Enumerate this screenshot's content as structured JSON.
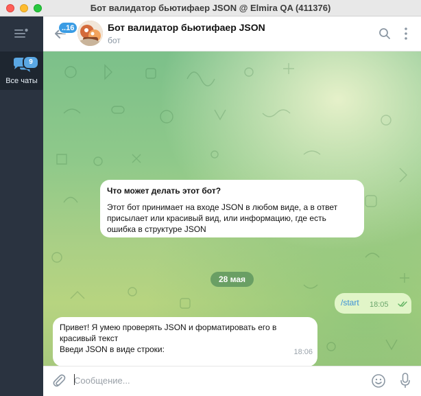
{
  "window": {
    "title": "Бот валидатор бьютифаер JSON @ Elmira QA (411376)"
  },
  "sidebar": {
    "folder_label": "Все чаты",
    "folder_badge": "9"
  },
  "header": {
    "back_badge": "..16",
    "chat_title": "Бот валидатор бьютифаер JSON",
    "chat_subtitle": "бот"
  },
  "messages": {
    "info_title": "Что может делать этот бот?",
    "info_text": "Этот бот принимает на входе JSON в любом виде, а в ответ присылает или красивый вид, или информацию, где есть ошибка в структуре JSON",
    "date_divider": "28 мая",
    "outgoing_text": "/start",
    "outgoing_time": "18:05",
    "incoming_line1": "Привет! Я умею проверять JSON и форматировать его в красивый текст",
    "incoming_line2": "Введи JSON в виде строки:",
    "incoming_time": "18:06"
  },
  "composer": {
    "placeholder": "Сообщение..."
  },
  "colors": {
    "sidebar_bg": "#2a3340",
    "accent_blue": "#3a9ce4",
    "outgoing_bubble": "#e1f5c8",
    "date_pill": "#5f965f"
  }
}
